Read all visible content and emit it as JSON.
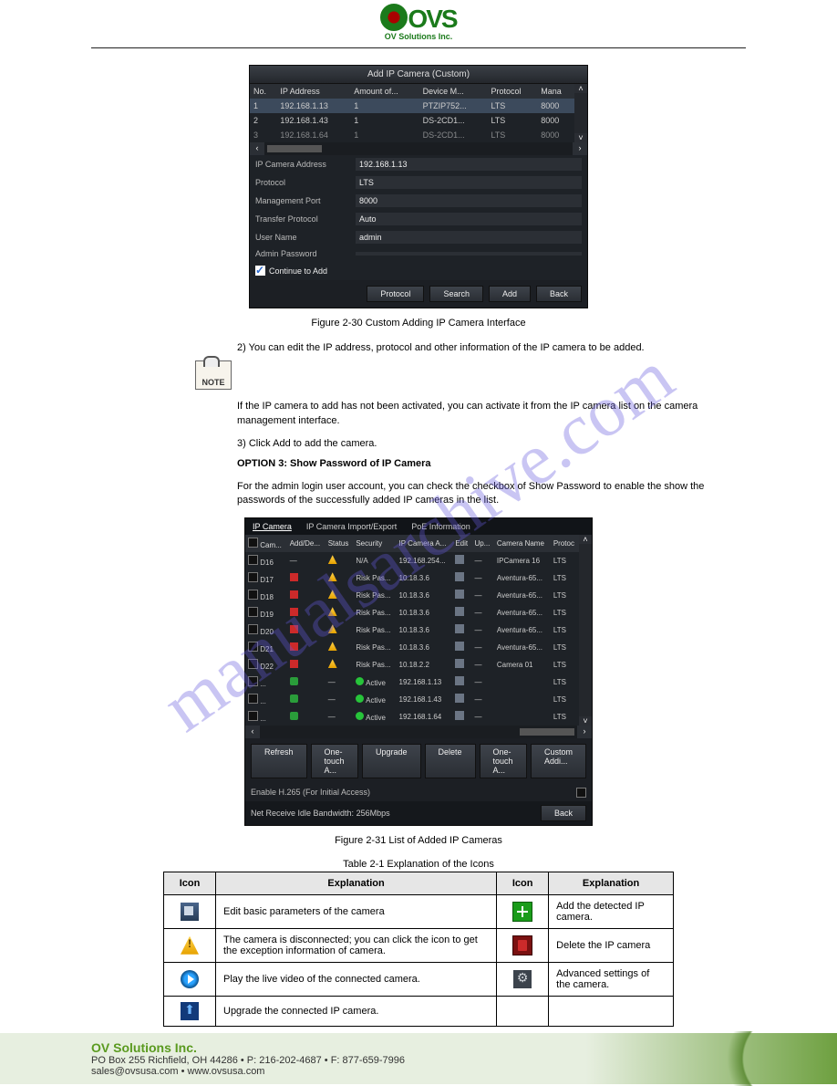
{
  "logo": {
    "brand": "OVS",
    "subtitle": "OV Solutions Inc."
  },
  "watermark": "manualsarchive.com",
  "panel1": {
    "title": "Add IP Camera (Custom)",
    "columns": [
      "No.",
      "IP Address",
      "Amount of...",
      "Device M...",
      "Protocol",
      "Mana"
    ],
    "rows": [
      {
        "no": "1",
        "ip": "192.168.1.13",
        "amount": "1",
        "model": "PTZIP752...",
        "protocol": "LTS",
        "port": "8000",
        "selected": true
      },
      {
        "no": "2",
        "ip": "192.168.1.43",
        "amount": "1",
        "model": "DS-2CD1...",
        "protocol": "LTS",
        "port": "8000"
      },
      {
        "no": "3",
        "ip": "192.168.1.64",
        "amount": "1",
        "model": "DS-2CD1...",
        "protocol": "LTS",
        "port": "8000"
      }
    ],
    "form": {
      "ip_camera_address": {
        "label": "IP Camera Address",
        "value": "192.168.1.13"
      },
      "protocol": {
        "label": "Protocol",
        "value": "LTS"
      },
      "management_port": {
        "label": "Management Port",
        "value": "8000"
      },
      "transfer_protocol": {
        "label": "Transfer Protocol",
        "value": "Auto"
      },
      "user_name": {
        "label": "User Name",
        "value": "admin"
      },
      "admin_password": {
        "label": "Admin Password",
        "value": ""
      }
    },
    "continue_label": "Continue to Add",
    "buttons": {
      "protocol": "Protocol",
      "search": "Search",
      "add": "Add",
      "back": "Back"
    }
  },
  "caption1": "Figure 2-30 Custom Adding IP Camera Interface",
  "note": {
    "badge": "NOTE",
    "text": "If the IP camera to add has not been activated, you can activate it from the IP camera list on the camera management interface."
  },
  "steps": {
    "s2": "2) You can edit the IP address, protocol and other information of the IP camera to be added.",
    "s3": "3) Click Add to add the camera.",
    "optionB": "OPTION 3: Show Password of IP Camera",
    "optionB_body": "For the admin login user account, you can check the checkbox of Show Password to enable the show the passwords of the successfully added IP cameras in the list."
  },
  "panel2": {
    "tabs": [
      "IP Camera",
      "IP Camera Import/Export",
      "PoE Information"
    ],
    "columns": [
      "Cam...",
      "Add/De...",
      "Status",
      "Security",
      "IP Camera A...",
      "Edit",
      "Up...",
      "Camera Name",
      "Protoc"
    ],
    "rows": [
      {
        "cam": "D16",
        "add": "—",
        "status": "warn",
        "security": "N/A",
        "ip": "192.168.254...",
        "edit": true,
        "up": "—",
        "name": "IPCamera 16",
        "protocol": "LTS"
      },
      {
        "cam": "D17",
        "add": "del",
        "status": "warn",
        "security": "Risk Pas...",
        "ip": "10.18.3.6",
        "edit": true,
        "up": "—",
        "name": "Aventura-65...",
        "protocol": "LTS"
      },
      {
        "cam": "D18",
        "add": "del",
        "status": "warn",
        "security": "Risk Pas...",
        "ip": "10.18.3.6",
        "edit": true,
        "up": "—",
        "name": "Aventura-65...",
        "protocol": "LTS"
      },
      {
        "cam": "D19",
        "add": "del",
        "status": "warn",
        "security": "Risk Pas...",
        "ip": "10.18.3.6",
        "edit": true,
        "up": "—",
        "name": "Aventura-65...",
        "protocol": "LTS"
      },
      {
        "cam": "D20",
        "add": "del",
        "status": "warn",
        "security": "Risk Pas...",
        "ip": "10.18.3.6",
        "edit": true,
        "up": "—",
        "name": "Aventura-65...",
        "protocol": "LTS"
      },
      {
        "cam": "D21",
        "add": "del",
        "status": "warn",
        "security": "Risk Pas...",
        "ip": "10.18.3.6",
        "edit": true,
        "up": "—",
        "name": "Aventura-65...",
        "protocol": "LTS"
      },
      {
        "cam": "D22",
        "add": "del",
        "status": "warn",
        "security": "Risk Pas...",
        "ip": "10.18.2.2",
        "edit": true,
        "up": "—",
        "name": "Camera 01",
        "protocol": "LTS"
      },
      {
        "cam": "...",
        "add": "add",
        "status": "—",
        "security_state": "active",
        "security": "Active",
        "ip": "192.168.1.13",
        "edit": true,
        "up": "—",
        "name": "",
        "protocol": "LTS"
      },
      {
        "cam": "...",
        "add": "add",
        "status": "—",
        "security_state": "active",
        "security": "Active",
        "ip": "192.168.1.43",
        "edit": true,
        "up": "—",
        "name": "",
        "protocol": "LTS"
      },
      {
        "cam": "...",
        "add": "add",
        "status": "—",
        "security_state": "active",
        "security": "Active",
        "ip": "192.168.1.64",
        "edit": true,
        "up": "—",
        "name": "",
        "protocol": "LTS"
      }
    ],
    "buttons": {
      "refresh": "Refresh",
      "one_touch_a": "One-touch A...",
      "upgrade": "Upgrade",
      "delete": "Delete",
      "one_touch_a2": "One-touch A...",
      "custom_add": "Custom Addi..."
    },
    "enable_h265": "Enable H.265 (For Initial Access)",
    "bandwidth": "Net Receive Idle Bandwidth: 256Mbps",
    "back": "Back"
  },
  "caption2": "Figure 2-31 List of Added IP Cameras",
  "icon_table": {
    "title": "Table 2-1 Explanation of the Icons",
    "headers": {
      "icon": "Icon",
      "explanation": "Explanation"
    },
    "icons": {
      "edit": "Edit basic parameters of the camera",
      "add": "Add the detected IP camera.",
      "warn": "The camera is disconnected; you can click the icon to get the exception information of camera.",
      "delete": "Delete the IP camera",
      "play": "Play the live video of the connected camera.",
      "advanced": "Advanced settings of the camera.",
      "upgrade": "Upgrade the connected IP camera."
    }
  },
  "footer": {
    "company": "OV Solutions Inc.",
    "address": "PO Box 255 Richfield, OH 44286  •  P: 216-202-4687 • F: 877-659-7996",
    "contact": "sales@ovsusa.com  •  www.ovsusa.com"
  }
}
